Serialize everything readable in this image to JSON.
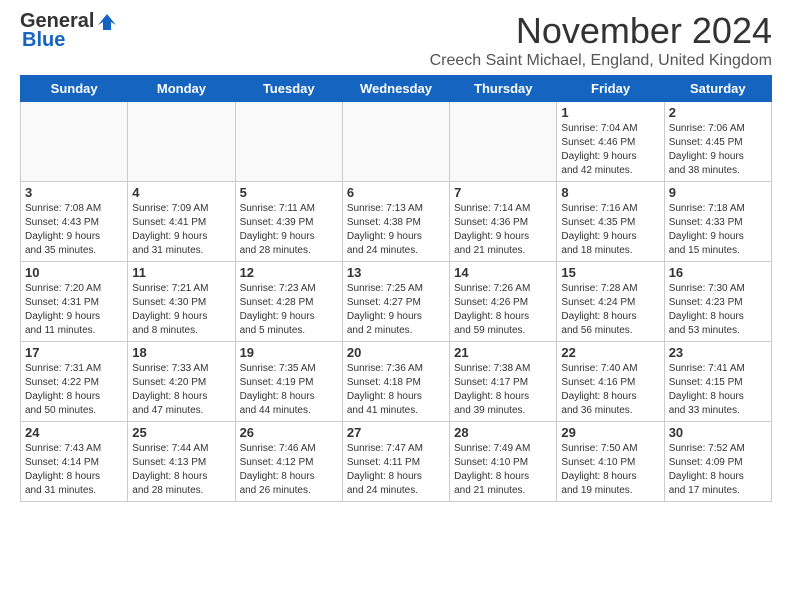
{
  "header": {
    "logo_general": "General",
    "logo_blue": "Blue",
    "month_title": "November 2024",
    "location": "Creech Saint Michael, England, United Kingdom"
  },
  "days_of_week": [
    "Sunday",
    "Monday",
    "Tuesday",
    "Wednesday",
    "Thursday",
    "Friday",
    "Saturday"
  ],
  "weeks": [
    [
      {
        "day": "",
        "info": ""
      },
      {
        "day": "",
        "info": ""
      },
      {
        "day": "",
        "info": ""
      },
      {
        "day": "",
        "info": ""
      },
      {
        "day": "",
        "info": ""
      },
      {
        "day": "1",
        "info": "Sunrise: 7:04 AM\nSunset: 4:46 PM\nDaylight: 9 hours\nand 42 minutes."
      },
      {
        "day": "2",
        "info": "Sunrise: 7:06 AM\nSunset: 4:45 PM\nDaylight: 9 hours\nand 38 minutes."
      }
    ],
    [
      {
        "day": "3",
        "info": "Sunrise: 7:08 AM\nSunset: 4:43 PM\nDaylight: 9 hours\nand 35 minutes."
      },
      {
        "day": "4",
        "info": "Sunrise: 7:09 AM\nSunset: 4:41 PM\nDaylight: 9 hours\nand 31 minutes."
      },
      {
        "day": "5",
        "info": "Sunrise: 7:11 AM\nSunset: 4:39 PM\nDaylight: 9 hours\nand 28 minutes."
      },
      {
        "day": "6",
        "info": "Sunrise: 7:13 AM\nSunset: 4:38 PM\nDaylight: 9 hours\nand 24 minutes."
      },
      {
        "day": "7",
        "info": "Sunrise: 7:14 AM\nSunset: 4:36 PM\nDaylight: 9 hours\nand 21 minutes."
      },
      {
        "day": "8",
        "info": "Sunrise: 7:16 AM\nSunset: 4:35 PM\nDaylight: 9 hours\nand 18 minutes."
      },
      {
        "day": "9",
        "info": "Sunrise: 7:18 AM\nSunset: 4:33 PM\nDaylight: 9 hours\nand 15 minutes."
      }
    ],
    [
      {
        "day": "10",
        "info": "Sunrise: 7:20 AM\nSunset: 4:31 PM\nDaylight: 9 hours\nand 11 minutes."
      },
      {
        "day": "11",
        "info": "Sunrise: 7:21 AM\nSunset: 4:30 PM\nDaylight: 9 hours\nand 8 minutes."
      },
      {
        "day": "12",
        "info": "Sunrise: 7:23 AM\nSunset: 4:28 PM\nDaylight: 9 hours\nand 5 minutes."
      },
      {
        "day": "13",
        "info": "Sunrise: 7:25 AM\nSunset: 4:27 PM\nDaylight: 9 hours\nand 2 minutes."
      },
      {
        "day": "14",
        "info": "Sunrise: 7:26 AM\nSunset: 4:26 PM\nDaylight: 8 hours\nand 59 minutes."
      },
      {
        "day": "15",
        "info": "Sunrise: 7:28 AM\nSunset: 4:24 PM\nDaylight: 8 hours\nand 56 minutes."
      },
      {
        "day": "16",
        "info": "Sunrise: 7:30 AM\nSunset: 4:23 PM\nDaylight: 8 hours\nand 53 minutes."
      }
    ],
    [
      {
        "day": "17",
        "info": "Sunrise: 7:31 AM\nSunset: 4:22 PM\nDaylight: 8 hours\nand 50 minutes."
      },
      {
        "day": "18",
        "info": "Sunrise: 7:33 AM\nSunset: 4:20 PM\nDaylight: 8 hours\nand 47 minutes."
      },
      {
        "day": "19",
        "info": "Sunrise: 7:35 AM\nSunset: 4:19 PM\nDaylight: 8 hours\nand 44 minutes."
      },
      {
        "day": "20",
        "info": "Sunrise: 7:36 AM\nSunset: 4:18 PM\nDaylight: 8 hours\nand 41 minutes."
      },
      {
        "day": "21",
        "info": "Sunrise: 7:38 AM\nSunset: 4:17 PM\nDaylight: 8 hours\nand 39 minutes."
      },
      {
        "day": "22",
        "info": "Sunrise: 7:40 AM\nSunset: 4:16 PM\nDaylight: 8 hours\nand 36 minutes."
      },
      {
        "day": "23",
        "info": "Sunrise: 7:41 AM\nSunset: 4:15 PM\nDaylight: 8 hours\nand 33 minutes."
      }
    ],
    [
      {
        "day": "24",
        "info": "Sunrise: 7:43 AM\nSunset: 4:14 PM\nDaylight: 8 hours\nand 31 minutes."
      },
      {
        "day": "25",
        "info": "Sunrise: 7:44 AM\nSunset: 4:13 PM\nDaylight: 8 hours\nand 28 minutes."
      },
      {
        "day": "26",
        "info": "Sunrise: 7:46 AM\nSunset: 4:12 PM\nDaylight: 8 hours\nand 26 minutes."
      },
      {
        "day": "27",
        "info": "Sunrise: 7:47 AM\nSunset: 4:11 PM\nDaylight: 8 hours\nand 24 minutes."
      },
      {
        "day": "28",
        "info": "Sunrise: 7:49 AM\nSunset: 4:10 PM\nDaylight: 8 hours\nand 21 minutes."
      },
      {
        "day": "29",
        "info": "Sunrise: 7:50 AM\nSunset: 4:10 PM\nDaylight: 8 hours\nand 19 minutes."
      },
      {
        "day": "30",
        "info": "Sunrise: 7:52 AM\nSunset: 4:09 PM\nDaylight: 8 hours\nand 17 minutes."
      }
    ]
  ]
}
